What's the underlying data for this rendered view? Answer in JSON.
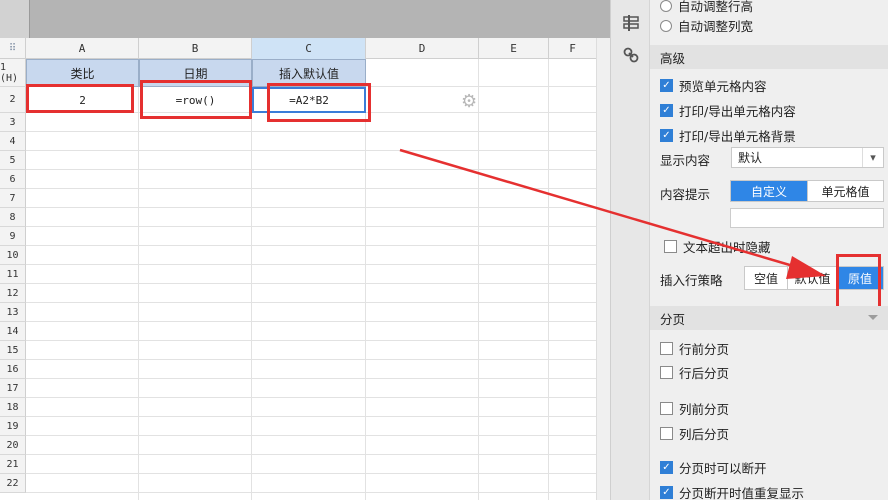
{
  "sheet": {
    "columns": [
      "A",
      "B",
      "C",
      "D",
      "E",
      "F"
    ],
    "rows": [
      "1 (H)",
      "2",
      "3",
      "4",
      "5",
      "6",
      "7",
      "8",
      "9",
      "10",
      "11",
      "12",
      "13",
      "14",
      "15",
      "16",
      "17",
      "18",
      "19",
      "20",
      "21",
      "22"
    ],
    "header_cells": {
      "a1": "类比",
      "b1": "日期",
      "c1": "插入默认值"
    },
    "row2": {
      "a2": "2",
      "b2": "=row()",
      "c2": "=A2*B2"
    }
  },
  "panel": {
    "radio_row_height": "自动调整行高",
    "radio_col_width": "自动调整列宽",
    "section_advanced": "高级",
    "cb_preview": "预览单元格内容",
    "cb_print_content": "打印/导出单元格内容",
    "cb_print_bg": "打印/导出单元格背景",
    "display_label": "显示内容",
    "display_value": "默认",
    "tooltip_label": "内容提示",
    "tooltip_custom": "自定义",
    "tooltip_cell": "单元格值",
    "cb_hide_overflow": "文本超出时隐藏",
    "insert_label": "插入行策略",
    "insert_empty": "空值",
    "insert_default": "默认值",
    "insert_original": "原值",
    "section_page": "分页",
    "cb_break_before_row": "行前分页",
    "cb_break_after_row": "行后分页",
    "cb_break_before_col": "列前分页",
    "cb_break_after_col": "列后分页",
    "cb_can_break": "分页时可以断开",
    "cb_repeat": "分页断开时值重复显示"
  },
  "colors": {
    "accent": "#2f86e6",
    "annotation_red": "#e53030",
    "header_fill": "#c8d8ee"
  }
}
